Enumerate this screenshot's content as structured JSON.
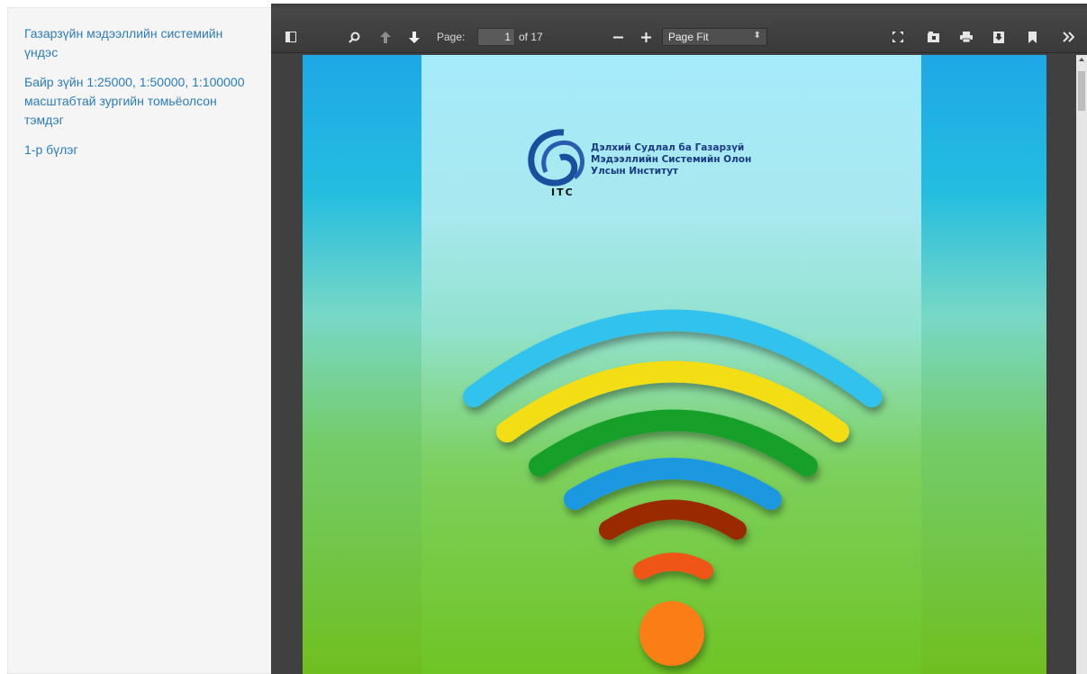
{
  "sidebar": {
    "links": [
      {
        "label": "Газарзүйн мэдээллийн системийн үндэс"
      },
      {
        "label": "Байр зүйн 1:25000, 1:50000, 1:100000 масштабтай зургийн томьёолсон тэмдэг"
      },
      {
        "label": "1-р бүлэг"
      }
    ]
  },
  "toolbar": {
    "page_label": "Page:",
    "page_value": "1",
    "page_of": "of 17",
    "zoom_value": "Page Fit",
    "icons": [
      "sidebar-toggle-icon",
      "search-icon",
      "previous-page-icon",
      "next-page-icon",
      "zoom-out-icon",
      "zoom-in-icon",
      "presentation-mode-icon",
      "open-file-icon",
      "print-icon",
      "download-icon",
      "bookmark-icon",
      "tools-icon"
    ]
  },
  "document": {
    "institute_lines": [
      "Дэлхий Судлал ба Газарзүй",
      "Мэдээллийн Системийн Олон",
      "Улсын Институт"
    ],
    "logo_text": "ITC",
    "colors": {
      "top": "#a9ecf7",
      "middle": "#8fe0cf",
      "bottom": "#6ec628",
      "arc_cyan": "#33c2ee",
      "arc_yellow": "#f3de16",
      "arc_green": "#16a02a",
      "arc_blue": "#1f98e0",
      "arc_brown": "#992a05",
      "arc_orange": "#ef5512",
      "dot": "#fb7d14"
    }
  }
}
